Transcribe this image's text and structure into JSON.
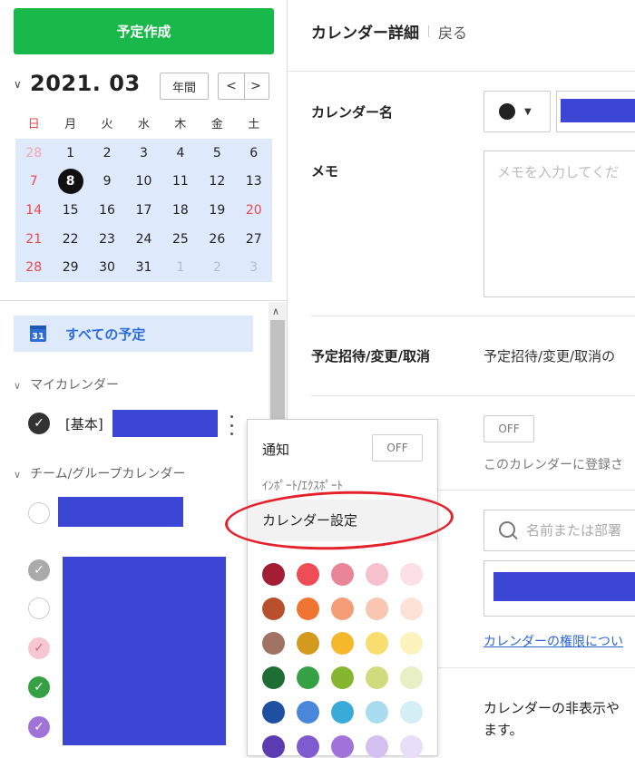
{
  "sidebar": {
    "create_button": "予定作成",
    "month_title": "2021. 03",
    "year_button": "年間",
    "prev_label": "<",
    "next_label": ">",
    "weekdays": [
      "日",
      "月",
      "火",
      "水",
      "木",
      "金",
      "土"
    ],
    "weeks": [
      [
        "28",
        "1",
        "2",
        "3",
        "4",
        "5",
        "6"
      ],
      [
        "7",
        "8",
        "9",
        "10",
        "11",
        "12",
        "13"
      ],
      [
        "14",
        "15",
        "16",
        "17",
        "18",
        "19",
        "20"
      ],
      [
        "21",
        "22",
        "23",
        "24",
        "25",
        "26",
        "27"
      ],
      [
        "28",
        "29",
        "30",
        "31",
        "1",
        "2",
        "3"
      ]
    ],
    "today": "8",
    "all_events_label": "すべての予定",
    "all_events_icon_text": "31",
    "my_calendar_label": "マイカレンダー",
    "my_calendar_item_prefix": "[基本]",
    "team_calendar_label": "チーム/グループカレンダー"
  },
  "detail": {
    "title": "カレンダー詳細",
    "back": "戻る",
    "name_label": "カレンダー名",
    "memo_label": "メモ",
    "memo_placeholder": "メモを入力してくだ",
    "invite_label": "予定招待/変更/取消",
    "invite_text": "予定招待/変更/取消の",
    "off_label": "OFF",
    "off_desc": "このカレンダーに登録さ",
    "search_placeholder": "名前または部署",
    "permission_link": "カレンダーの権限につい",
    "hide_text_1": "カレンダーの非表示や",
    "hide_text_2": "ます。"
  },
  "popup": {
    "notify_label": "通知",
    "notify_toggle": "OFF",
    "import_export": "ｲﾝﾎﾟｰﾄ/ｴｸｽﾎﾟｰﾄ",
    "settings": "カレンダー設定",
    "swatch_colors": [
      [
        "#a31e35",
        "#ef4d55",
        "#e98597",
        "#f7c0cd",
        "#fbdfe5"
      ],
      [
        "#b8502e",
        "#f07432",
        "#f59d76",
        "#f8c6b1",
        "#fbe1d6"
      ],
      [
        "#a07362",
        "#d49a1f",
        "#f4b82a",
        "#f7de6e",
        "#fbf2bd"
      ],
      [
        "#1e6e34",
        "#36a045",
        "#86b52f",
        "#cedc7d",
        "#e8efc4"
      ],
      [
        "#1f4fa0",
        "#4a87da",
        "#3aaad9",
        "#a9dcef",
        "#d4eef5"
      ],
      [
        "#5b3ab2",
        "#7f5bd0",
        "#a173d9",
        "#d3bff0",
        "#e9defa"
      ]
    ]
  },
  "colors": {
    "accent_green": "#19b84b",
    "accent_blue": "#2c6ed6",
    "redacted": "#3b47d4",
    "highlight_red": "#e5212b"
  }
}
